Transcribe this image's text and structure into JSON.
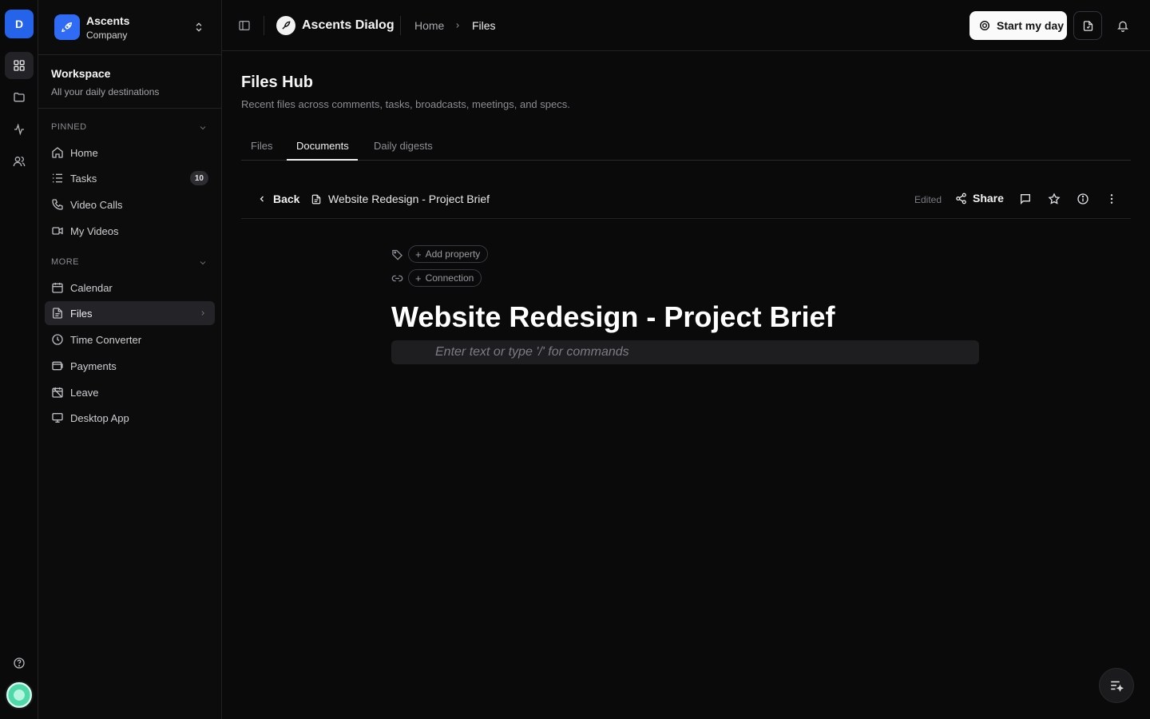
{
  "rail": {
    "workspace_initial": "D"
  },
  "sidebar": {
    "company": {
      "name_line1": "Ascents",
      "name_line2": "Company"
    },
    "workspace": {
      "title": "Workspace",
      "subtitle": "All your daily destinations"
    },
    "pinned_label": "PINNED",
    "pinned": [
      {
        "label": "Home",
        "icon": "home-icon"
      },
      {
        "label": "Tasks",
        "icon": "tasks-icon",
        "badge": "10"
      },
      {
        "label": "Video Calls",
        "icon": "phone-icon"
      },
      {
        "label": "My Videos",
        "icon": "video-icon"
      }
    ],
    "more_label": "MORE",
    "more": [
      {
        "label": "Calendar",
        "icon": "calendar-icon"
      },
      {
        "label": "Files",
        "icon": "file-icon",
        "active": true
      },
      {
        "label": "Time Converter",
        "icon": "clock-icon"
      },
      {
        "label": "Payments",
        "icon": "payments-icon"
      },
      {
        "label": "Leave",
        "icon": "calendar-off-icon"
      },
      {
        "label": "Desktop App",
        "icon": "monitor-icon"
      }
    ]
  },
  "topbar": {
    "app_name": "Ascents Dialog",
    "breadcrumb": {
      "home": "Home",
      "current": "Files"
    },
    "start_button": "Start my day"
  },
  "main": {
    "title": "Files Hub",
    "subtitle": "Recent files across comments, tasks, broadcasts, meetings, and specs.",
    "tabs": [
      {
        "label": "Files"
      },
      {
        "label": "Documents",
        "active": true
      },
      {
        "label": "Daily digests"
      }
    ],
    "doc_bar": {
      "back_label": "Back",
      "doc_name": "Website Redesign - Project Brief",
      "status": "Edited",
      "share_label": "Share"
    },
    "editor": {
      "add_property": "Add property",
      "connection": "Connection",
      "title": "Website Redesign - Project Brief",
      "placeholder": "Enter text or type '/' for commands"
    }
  },
  "colors": {
    "background": "#0a0a0b",
    "accent": "#2563eb",
    "active_item": "#242428"
  }
}
